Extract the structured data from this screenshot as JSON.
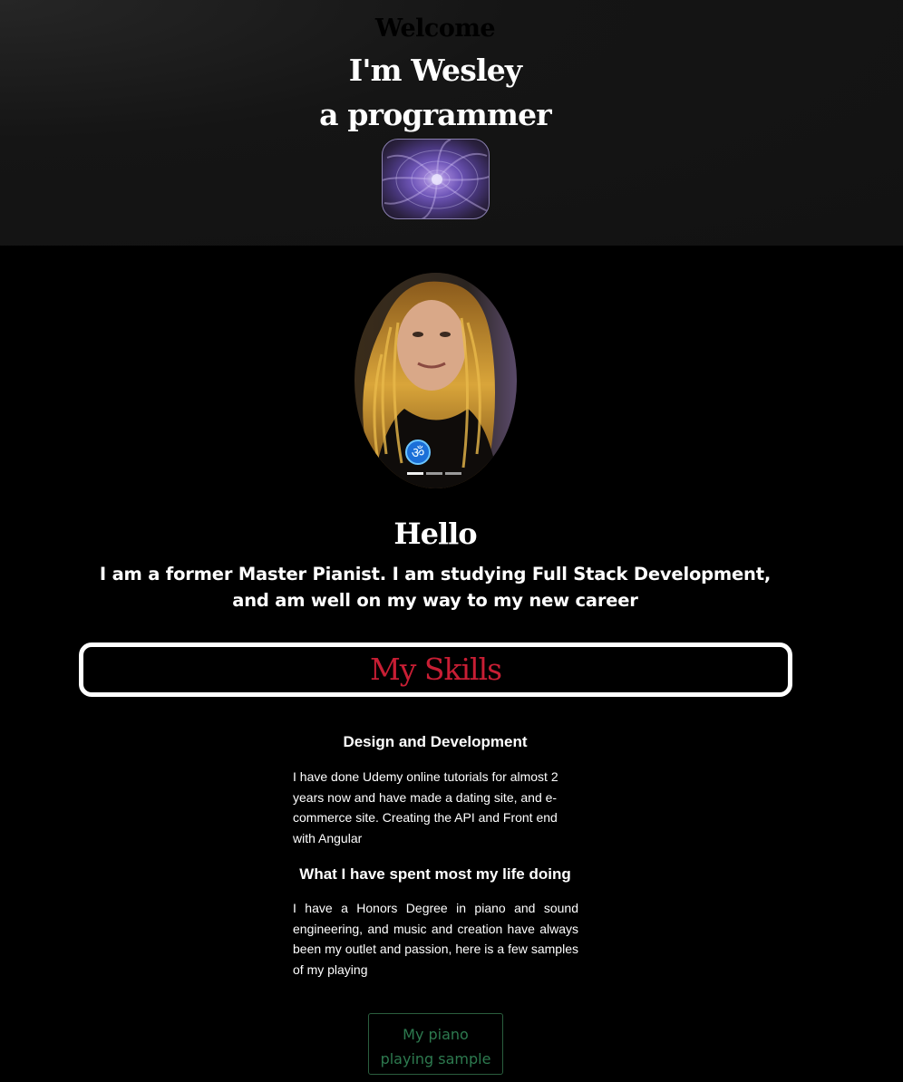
{
  "hero": {
    "welcome": "Welcome",
    "name_line": "I'm Wesley",
    "role_line": "a programmer",
    "logo_icon": "purple-vortex-logo"
  },
  "portrait": {
    "image": "profile-photo-portrait",
    "carousel_indicators": 3,
    "active_indicator": 1
  },
  "intro": {
    "heading": "Hello",
    "text": "I am a former Master Pianist. I am studying Full Stack Development, and am well on my way to my new career"
  },
  "skills": {
    "title": "My Skills",
    "title_color": "#c81e34",
    "items": [
      {
        "heading": "Design and Development",
        "text": "I have done Udemy online tutorials for almost 2 years now and have made a dating site, and e-commerce site. Creating the API and Front end with Angular"
      },
      {
        "heading": "What I have spent most my life doing",
        "text": "I have a Honors Degree in piano and sound engineering, and music and creation have always been my outlet and passion, here is a few samples of my playing"
      }
    ]
  },
  "sample_button": {
    "line1": "My piano",
    "line2": "playing sample",
    "color": "#2d7a4f"
  }
}
